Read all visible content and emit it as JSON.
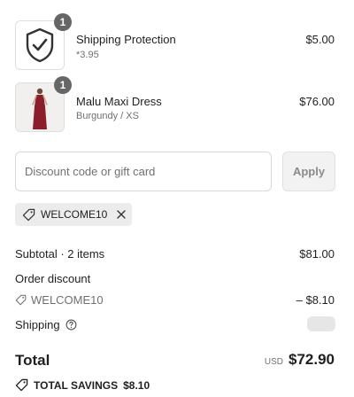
{
  "items": [
    {
      "name": "Shipping Protection",
      "subtitle": "*3.95",
      "price": "$5.00",
      "quantity": "1",
      "thumbnail_icon": "shield-check-icon"
    },
    {
      "name": "Malu Maxi Dress",
      "subtitle": "Burgundy / XS",
      "price": "$76.00",
      "quantity": "1",
      "thumbnail_icon": "dress-photo"
    }
  ],
  "discount": {
    "placeholder": "Discount code or gift card",
    "value": "",
    "apply_label": "Apply",
    "applied_code": "WELCOME10"
  },
  "summary": {
    "subtotal_label": "Subtotal · 2 items",
    "subtotal_value": "$81.00",
    "order_discount_label": "Order discount",
    "discount_code": "WELCOME10",
    "discount_value": "– $8.10",
    "shipping_label": "Shipping",
    "total_label": "Total",
    "total_currency": "USD",
    "total_value": "$72.90",
    "savings_label": "TOTAL SAVINGS",
    "savings_value": "$8.10"
  },
  "colors": {
    "badge": "#666666",
    "dress": "#8b1e2b",
    "chip_bg": "#ececec"
  }
}
